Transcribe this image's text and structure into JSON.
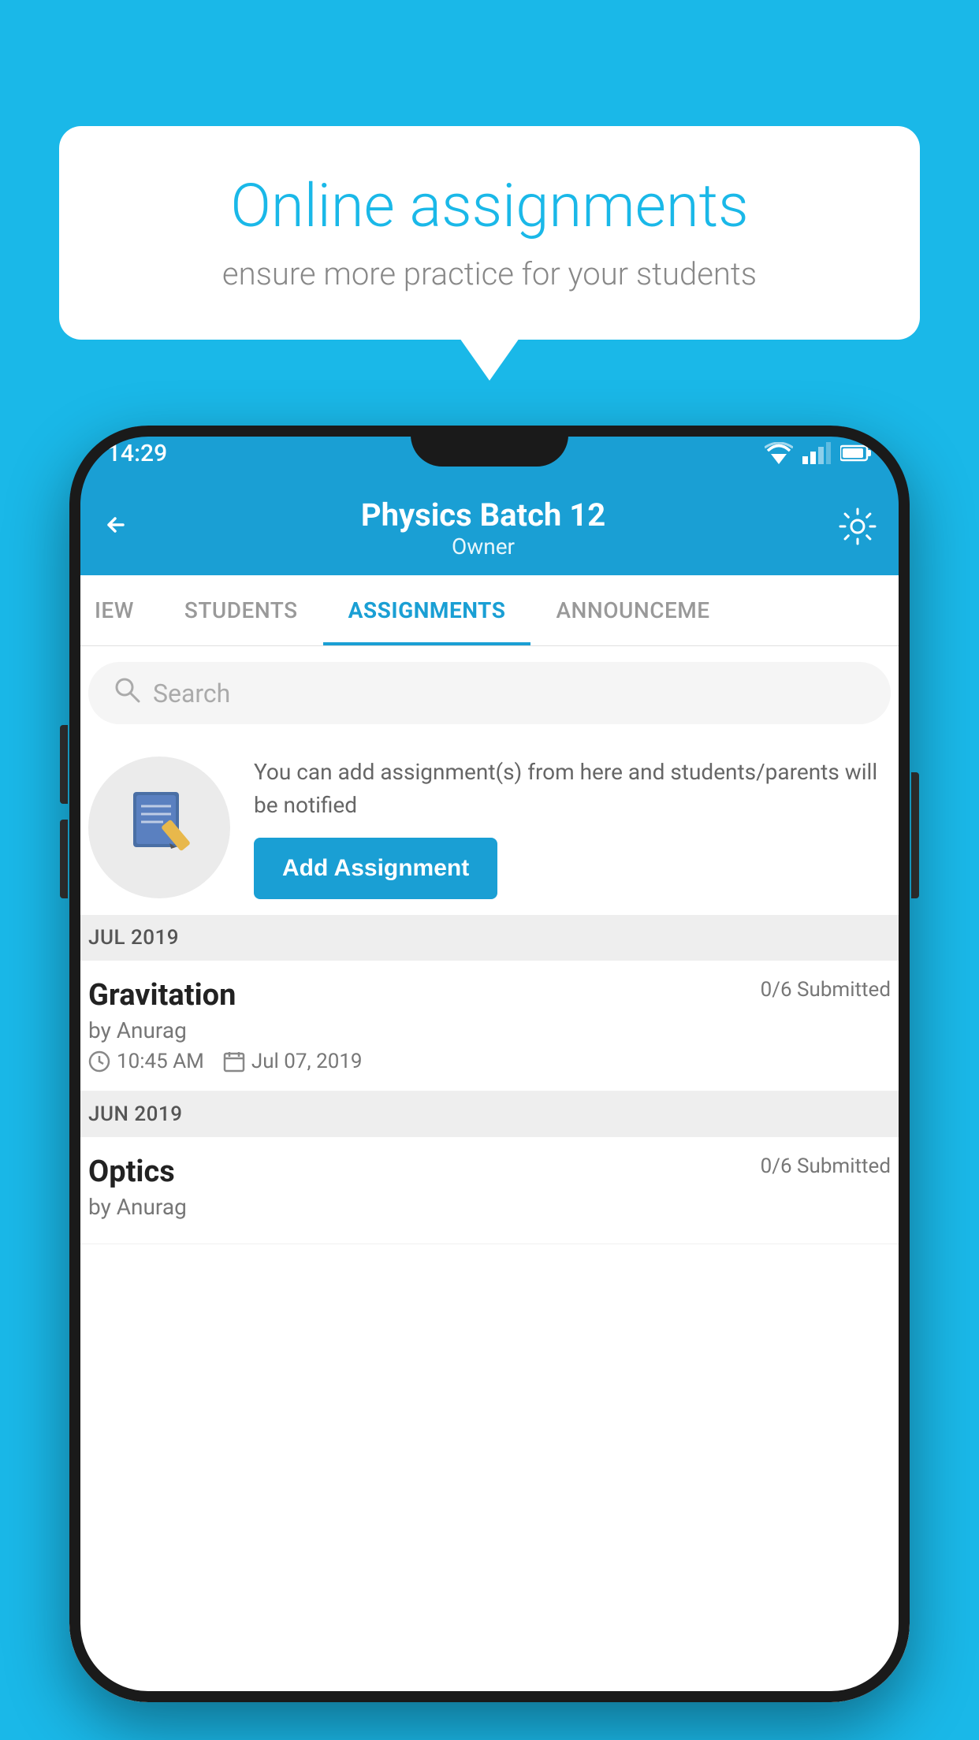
{
  "background_color": "#1ab8e8",
  "speech_bubble": {
    "title": "Online assignments",
    "subtitle": "ensure more practice for your students"
  },
  "status_bar": {
    "time": "14:29"
  },
  "header": {
    "title": "Physics Batch 12",
    "subtitle": "Owner"
  },
  "tabs": [
    {
      "id": "overview",
      "label": "IEW",
      "active": false
    },
    {
      "id": "students",
      "label": "STUDENTS",
      "active": false
    },
    {
      "id": "assignments",
      "label": "ASSIGNMENTS",
      "active": true
    },
    {
      "id": "announcements",
      "label": "ANNOUNCEME",
      "active": false
    }
  ],
  "search": {
    "placeholder": "Search"
  },
  "promo": {
    "description": "You can add assignment(s) from here and students/parents will be notified",
    "button_label": "Add Assignment"
  },
  "sections": [
    {
      "month_label": "JUL 2019",
      "assignments": [
        {
          "title": "Gravitation",
          "submitted": "0/6 Submitted",
          "by": "by Anurag",
          "time": "10:45 AM",
          "date": "Jul 07, 2019"
        }
      ]
    },
    {
      "month_label": "JUN 2019",
      "assignments": [
        {
          "title": "Optics",
          "submitted": "0/6 Submitted",
          "by": "by Anurag",
          "time": "",
          "date": ""
        }
      ]
    }
  ]
}
